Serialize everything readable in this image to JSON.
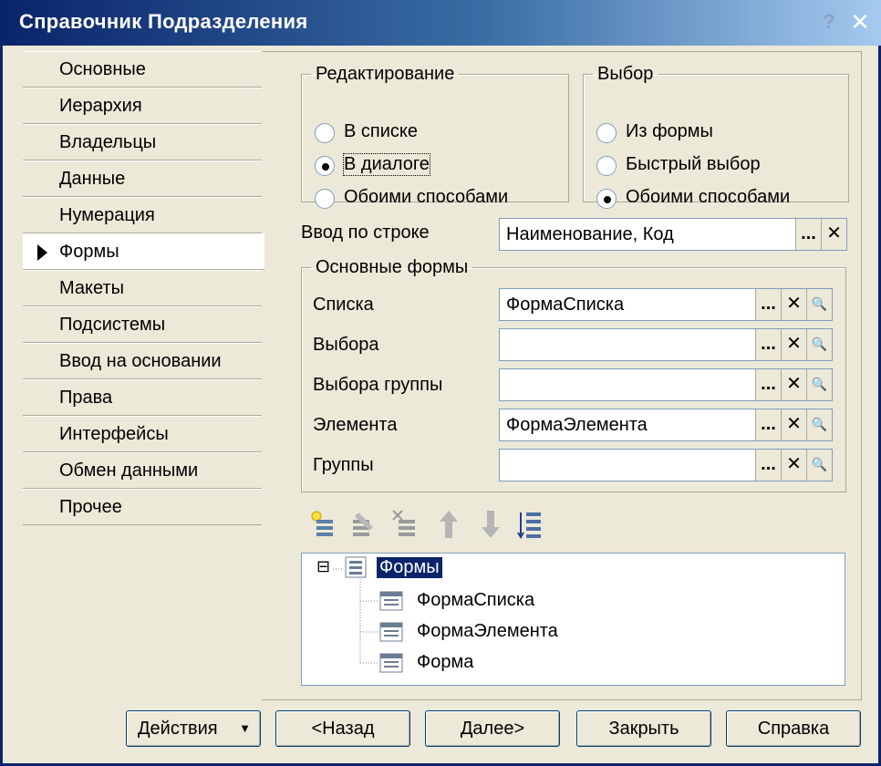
{
  "window": {
    "title": "Справочник Подразделения"
  },
  "tabs": [
    {
      "label": "Основные",
      "active": false
    },
    {
      "label": "Иерархия",
      "active": false
    },
    {
      "label": "Владельцы",
      "active": false
    },
    {
      "label": "Данные",
      "active": false
    },
    {
      "label": "Нумерация",
      "active": false
    },
    {
      "label": "Формы",
      "active": true
    },
    {
      "label": "Макеты",
      "active": false
    },
    {
      "label": "Подсистемы",
      "active": false
    },
    {
      "label": "Ввод на основании",
      "active": false
    },
    {
      "label": "Права",
      "active": false
    },
    {
      "label": "Интерфейсы",
      "active": false
    },
    {
      "label": "Обмен данными",
      "active": false
    },
    {
      "label": "Прочее",
      "active": false
    }
  ],
  "editing": {
    "legend": "Редактирование",
    "options": [
      "В списке",
      "В диалоге",
      "Обоими способами"
    ],
    "selected": 1
  },
  "choice": {
    "legend": "Выбор",
    "options": [
      "Из формы",
      "Быстрый выбор",
      "Обоими способами"
    ],
    "selected": 2
  },
  "input_by_string": {
    "label": "Ввод по строке",
    "value": "Наименование, Код"
  },
  "main_forms": {
    "legend": "Основные формы",
    "rows": [
      {
        "label": "Списка",
        "value": "ФормаСписка"
      },
      {
        "label": "Выбора",
        "value": ""
      },
      {
        "label": "Выбора группы",
        "value": ""
      },
      {
        "label": "Элемента",
        "value": "ФормаЭлемента"
      },
      {
        "label": "Группы",
        "value": ""
      }
    ]
  },
  "field_buttons": {
    "select": "...",
    "clear": "✕",
    "open": "🔍"
  },
  "tree": {
    "root": "Формы",
    "children": [
      "ФормаСписка",
      "ФормаЭлемента",
      "Форма"
    ],
    "expander": "⊟"
  },
  "buttons": {
    "actions": "Действия",
    "back": "<Назад",
    "next": "Далее>",
    "close": "Закрыть",
    "help": "Справка"
  }
}
